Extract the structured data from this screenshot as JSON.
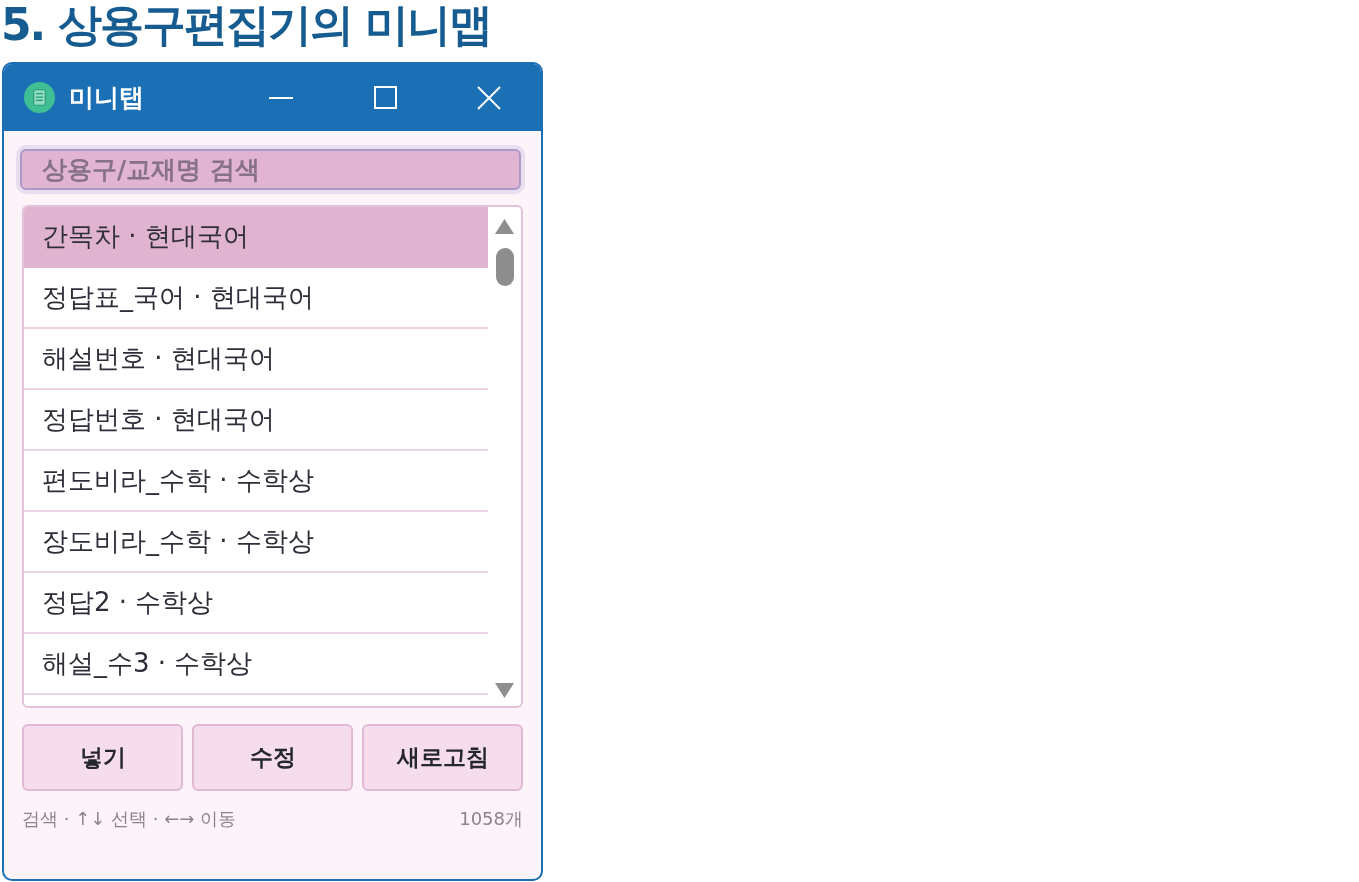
{
  "heading": "5. 상용구편집기의 미니맵",
  "window": {
    "title": "미니탭"
  },
  "search": {
    "placeholder": "상용구/교재명 검색"
  },
  "list": {
    "items": [
      {
        "label": "간목차 · 현대국어",
        "selected": true
      },
      {
        "label": "정답표_국어 · 현대국어",
        "selected": false
      },
      {
        "label": "해설번호 · 현대국어",
        "selected": false
      },
      {
        "label": "정답번호 · 현대국어",
        "selected": false
      },
      {
        "label": "편도비라_수학 · 수학상",
        "selected": false
      },
      {
        "label": "장도비라_수학 · 수학상",
        "selected": false
      },
      {
        "label": "정답2 · 수학상",
        "selected": false
      },
      {
        "label": "해설_수3 · 수학상",
        "selected": false
      }
    ]
  },
  "buttons": [
    "넣기",
    "수정",
    "새로고침"
  ],
  "status_bar": {
    "hint": "검색 · ↑↓ 선택 · ←→ 이동",
    "count": "1058개"
  }
}
